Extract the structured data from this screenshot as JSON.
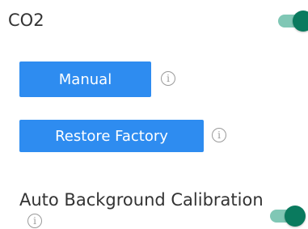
{
  "co2": {
    "label": "CO2",
    "toggle_on": true
  },
  "manual_button": {
    "label": "Manual",
    "info_glyph": "i"
  },
  "restore_button": {
    "label": "Restore Factory",
    "info_glyph": "i"
  },
  "auto_background_calibration": {
    "label": "Auto Background Calibration",
    "info_glyph": "i",
    "toggle_on": true
  },
  "colors": {
    "button": "#2e8cf0",
    "toggle_track": "#80c7b5",
    "toggle_knob": "#0a7a5e",
    "info_icon": "#9a9a9a",
    "text": "#333333"
  },
  "icons": {
    "info": "info-circle-icon",
    "toggle": "toggle-switch"
  }
}
